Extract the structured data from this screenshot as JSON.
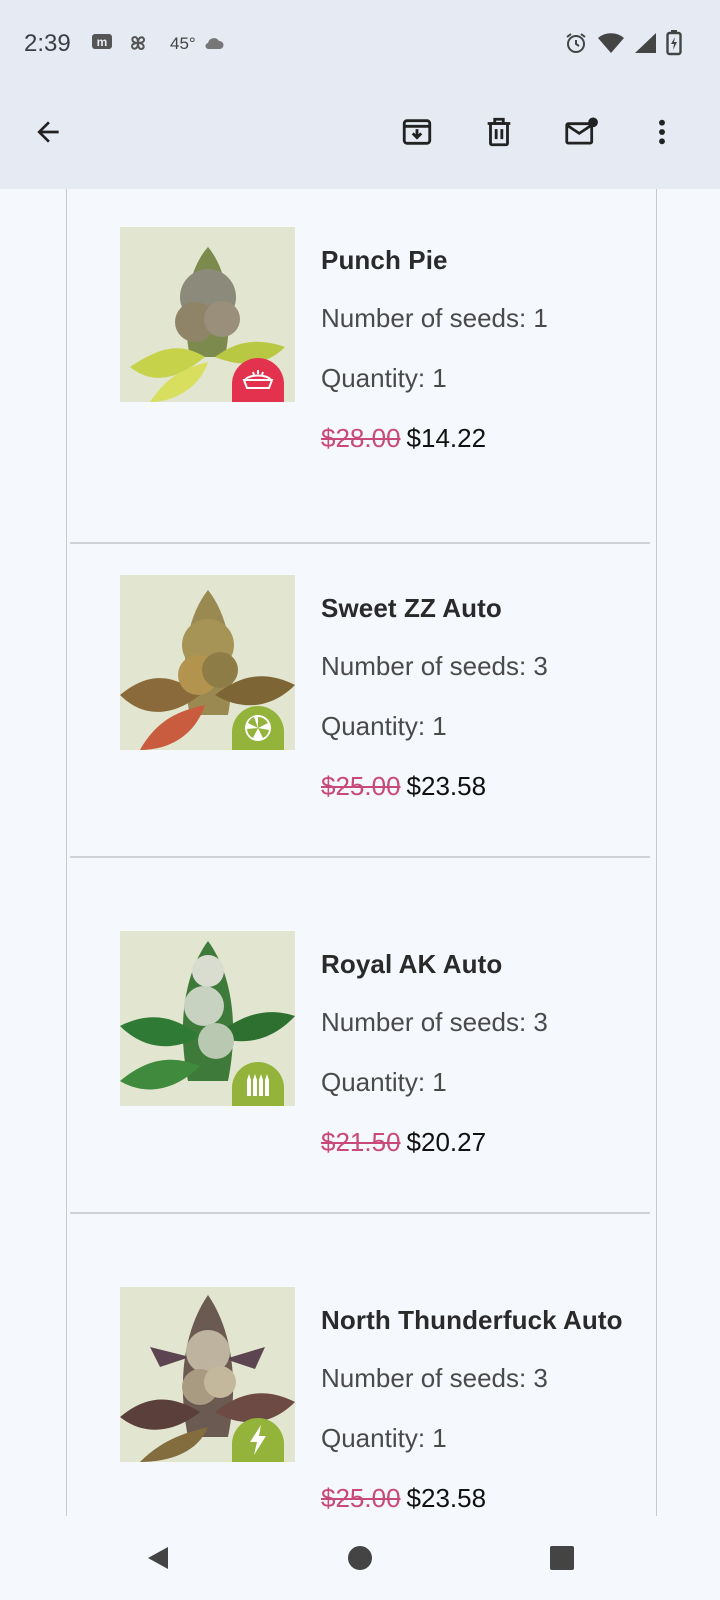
{
  "status_bar": {
    "time": "2:39",
    "temperature": "45°",
    "icons_left": [
      "m-app-icon",
      "pinwheel-icon",
      "cloud-icon"
    ],
    "icons_right": [
      "alarm-icon",
      "wifi-icon",
      "signal-icon",
      "battery-charging-icon"
    ]
  },
  "app_bar": {
    "actions": [
      "back-icon",
      "archive-icon",
      "delete-icon",
      "mark-unread-icon",
      "more-vert-icon"
    ]
  },
  "products": [
    {
      "name": "Punch Pie",
      "seeds_label": "Number of seeds: 1",
      "quantity_label": "Quantity: 1",
      "old_price": "$28.00",
      "new_price": "$14.22",
      "badge_icon": "pie-icon",
      "badge_color": "#e2324e"
    },
    {
      "name": "Sweet ZZ Auto",
      "seeds_label": "Number of seeds: 3",
      "quantity_label": "Quantity: 1",
      "old_price": "$25.00",
      "new_price": "$23.58",
      "badge_icon": "autoflower-icon",
      "badge_color": "#93b33a"
    },
    {
      "name": "Royal AK Auto",
      "seeds_label": "Number of seeds: 3",
      "quantity_label": "Quantity: 1",
      "old_price": "$21.50",
      "new_price": "$20.27",
      "badge_icon": "ammo-icon",
      "badge_color": "#93b33a"
    },
    {
      "name": "North Thunderfuck Auto",
      "seeds_label": "Number of seeds: 3",
      "quantity_label": "Quantity: 1",
      "old_price": "$25.00",
      "new_price": "$23.58",
      "badge_icon": "lightning-icon",
      "badge_color": "#93b33a"
    }
  ],
  "nav_bar": {
    "buttons": [
      "back-triangle-icon",
      "home-circle-icon",
      "recents-square-icon"
    ]
  },
  "colors": {
    "app_bar_bg": "#e6ebf3",
    "page_bg": "#f5f8fc",
    "old_price": "#c8497a",
    "badge_green": "#93b33a",
    "badge_red": "#e2324e"
  }
}
